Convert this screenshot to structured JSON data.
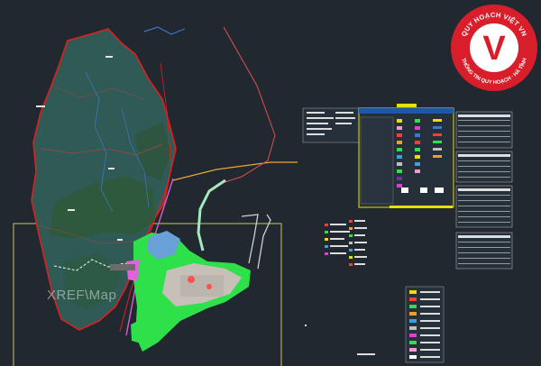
{
  "viewport": {
    "background_color": "#212830",
    "xref_label": "XREF\\Map"
  },
  "map": {
    "boundary_color": "#e02020",
    "terrain_color": "#2f5a55",
    "forest_color": "#2e5a3c",
    "urban_green_color": "#2ee04a",
    "road_color": "#f2a33a",
    "river_color": "#3a78c8",
    "frame_color": "#c8c864"
  },
  "legend_panels": {
    "count": 6
  },
  "watermark_logo": {
    "letter": "V",
    "text_top": "QUY HOẠCH VIỆT VN",
    "text_bottom": "THÔNG TIN QUY HOẠCH · HÀ TĨNH",
    "ring_color": "#d81e2a",
    "face_color": "#ffffff"
  }
}
